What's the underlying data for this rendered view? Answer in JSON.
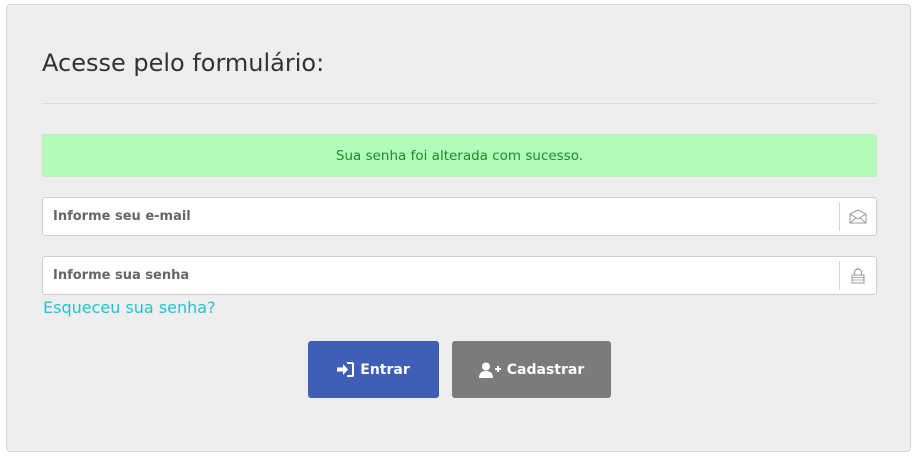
{
  "form": {
    "title": "Acesse pelo formulário:",
    "alert_message": "Sua senha foi alterada com sucesso.",
    "email_placeholder": "Informe seu e-mail",
    "email_icon": "envelope-icon",
    "password_placeholder": "Informe sua senha",
    "password_icon": "lock-icon",
    "forgot_link": "Esqueceu sua senha?",
    "login_button": "Entrar",
    "login_icon": "sign-in-icon",
    "register_button": "Cadastrar",
    "register_icon": "user-plus-icon"
  },
  "colors": {
    "panel_bg": "#eeeeee",
    "alert_bg": "#b0fcb8",
    "alert_text": "#1e8a2a",
    "link": "#22c3d3",
    "primary_button": "#3f5fb7",
    "secondary_button": "#7b7b7b"
  }
}
